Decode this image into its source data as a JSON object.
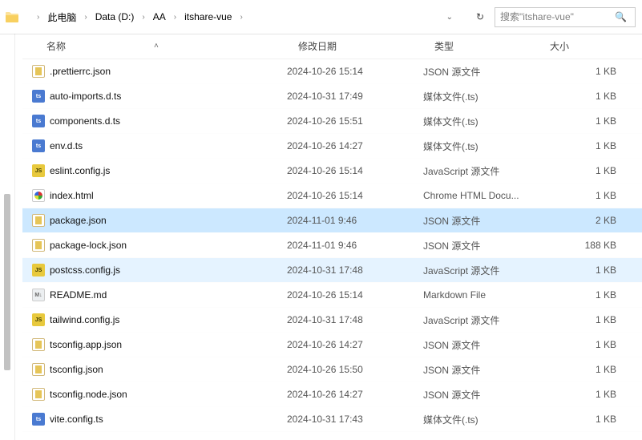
{
  "breadcrumb": {
    "items": [
      {
        "label": "此电脑"
      },
      {
        "label": "Data (D:)"
      },
      {
        "label": "AA"
      },
      {
        "label": "itshare-vue"
      }
    ]
  },
  "search": {
    "placeholder": "搜索\"itshare-vue\""
  },
  "columns": {
    "name": "名称",
    "modified": "修改日期",
    "type": "类型",
    "size": "大小"
  },
  "files": [
    {
      "icon": "json",
      "name": ".prettierrc.json",
      "modified": "2024-10-26 15:14",
      "type": "JSON 源文件",
      "size": "1 KB",
      "state": ""
    },
    {
      "icon": "ts",
      "name": "auto-imports.d.ts",
      "modified": "2024-10-31 17:49",
      "type": "媒体文件(.ts)",
      "size": "1 KB",
      "state": ""
    },
    {
      "icon": "ts",
      "name": "components.d.ts",
      "modified": "2024-10-26 15:51",
      "type": "媒体文件(.ts)",
      "size": "1 KB",
      "state": ""
    },
    {
      "icon": "ts",
      "name": "env.d.ts",
      "modified": "2024-10-26 14:27",
      "type": "媒体文件(.ts)",
      "size": "1 KB",
      "state": ""
    },
    {
      "icon": "js",
      "name": "eslint.config.js",
      "modified": "2024-10-26 15:14",
      "type": "JavaScript 源文件",
      "size": "1 KB",
      "state": ""
    },
    {
      "icon": "html",
      "name": "index.html",
      "modified": "2024-10-26 15:14",
      "type": "Chrome HTML Docu...",
      "size": "1 KB",
      "state": ""
    },
    {
      "icon": "json",
      "name": "package.json",
      "modified": "2024-11-01 9:46",
      "type": "JSON 源文件",
      "size": "2 KB",
      "state": "selected"
    },
    {
      "icon": "json",
      "name": "package-lock.json",
      "modified": "2024-11-01 9:46",
      "type": "JSON 源文件",
      "size": "188 KB",
      "state": ""
    },
    {
      "icon": "js",
      "name": "postcss.config.js",
      "modified": "2024-10-31 17:48",
      "type": "JavaScript 源文件",
      "size": "1 KB",
      "state": "hover"
    },
    {
      "icon": "md",
      "name": "README.md",
      "modified": "2024-10-26 15:14",
      "type": "Markdown File",
      "size": "1 KB",
      "state": ""
    },
    {
      "icon": "js",
      "name": "tailwind.config.js",
      "modified": "2024-10-31 17:48",
      "type": "JavaScript 源文件",
      "size": "1 KB",
      "state": ""
    },
    {
      "icon": "json",
      "name": "tsconfig.app.json",
      "modified": "2024-10-26 14:27",
      "type": "JSON 源文件",
      "size": "1 KB",
      "state": ""
    },
    {
      "icon": "json",
      "name": "tsconfig.json",
      "modified": "2024-10-26 15:50",
      "type": "JSON 源文件",
      "size": "1 KB",
      "state": ""
    },
    {
      "icon": "json",
      "name": "tsconfig.node.json",
      "modified": "2024-10-26 14:27",
      "type": "JSON 源文件",
      "size": "1 KB",
      "state": ""
    },
    {
      "icon": "ts",
      "name": "vite.config.ts",
      "modified": "2024-10-31 17:43",
      "type": "媒体文件(.ts)",
      "size": "1 KB",
      "state": ""
    }
  ]
}
